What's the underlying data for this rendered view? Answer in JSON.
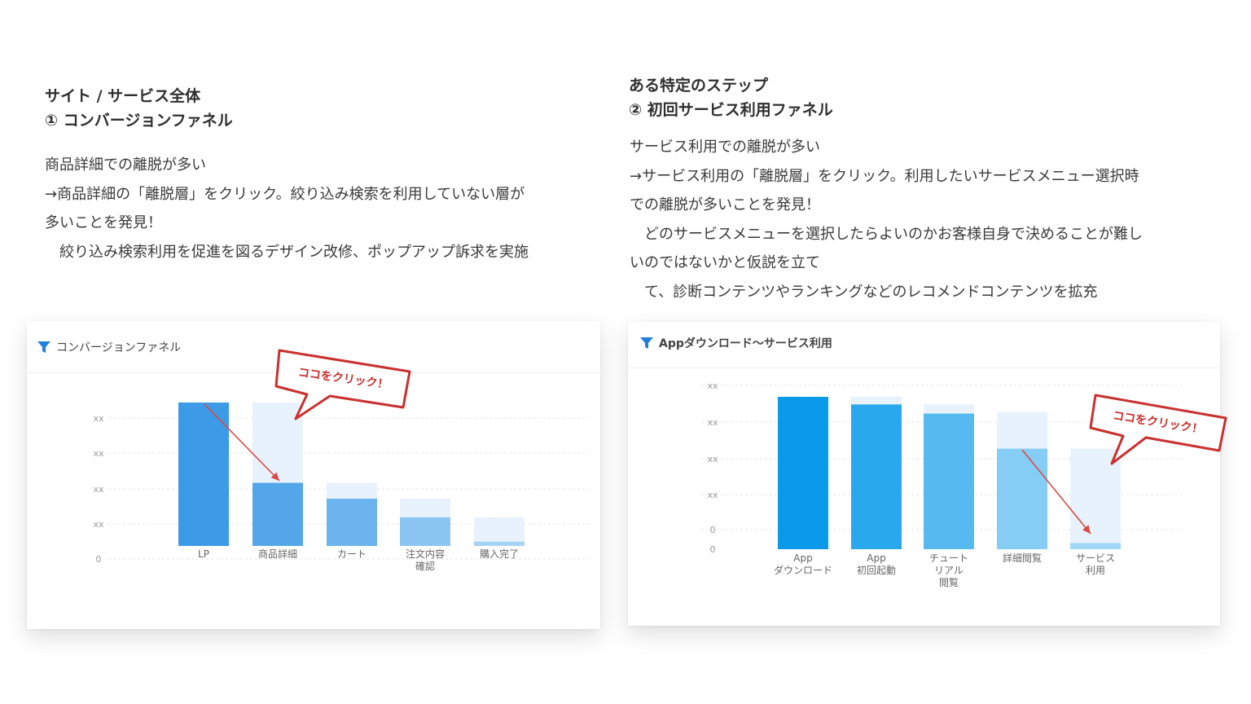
{
  "left": {
    "heading_line1": "サイト / サービス全体",
    "heading_line2": "① コンバージョンファネル",
    "body": [
      "商品詳細での離脱が多い",
      "→商品詳細の「離脱層」をクリック。絞り込み検索を利用していない層が",
      "多いことを発見！",
      "　絞り込み検索利用を促進を図るデザイン改修、ポップアップ訴求を実施"
    ]
  },
  "right": {
    "heading_line1": "ある特定のステップ",
    "heading_line2": "② 初回サービス利用ファネル",
    "body": [
      "サービス利用での離脱が多い",
      "→サービス利用の「離脱層」をクリック。利用したいサービスメニュー選択時",
      "での離脱が多いことを発見！",
      "　どのサービスメニューを選択したらよいのかお客様自身で決めることが難し",
      "いのではないかと仮説を立て",
      "　て、診断コンテンツやランキングなどのレコメンドコンテンツを拡充"
    ]
  },
  "colors": {
    "accent_blue": "#1f7fe0",
    "callout_red": "#c8312f",
    "dropoff_fill": "#e8f2fc"
  },
  "icons": {
    "card_title": "funnel-icon"
  },
  "chart_data": [
    {
      "type": "bar",
      "title": "コンバージョンファネル",
      "categories": [
        "LP",
        "商品詳細",
        "カート",
        "注文内容\n確認",
        "購入完了"
      ],
      "series": [
        {
          "values": [
            100,
            44,
            33,
            20,
            3
          ]
        },
        {
          "values": [
            0,
            56,
            11,
            13,
            17
          ]
        }
      ],
      "ytick_labels": [
        "xx",
        "xx",
        "xx",
        "xx",
        "0"
      ],
      "ylim": [
        0,
        100
      ],
      "grid": true,
      "bar_colors": [
        "#3d9ae6",
        "#53a6ea",
        "#6cb4ee",
        "#8bc5f2",
        "#a6d3f5"
      ],
      "annotation": "ココをクリック！"
    },
    {
      "type": "bar",
      "title": "Appダウンロード〜サービス利用",
      "categories": [
        "App\nダウンロード",
        "App\n初回起動",
        "チュート\nリアル\n閲覧",
        "詳細閲覧",
        "サービス\n利用"
      ],
      "series": [
        {
          "values": [
            100,
            95,
            89,
            66,
            4
          ]
        },
        {
          "values": [
            0,
            5,
            6,
            24,
            62
          ]
        }
      ],
      "ytick_labels": [
        "xx",
        "xx",
        "xx",
        "xx",
        "0",
        "0"
      ],
      "ylim": [
        0,
        100
      ],
      "grid": true,
      "bar_colors": [
        "#0b9aea",
        "#2aa8ed",
        "#56b9f0",
        "#86cdf5",
        "#9fd7f7"
      ],
      "annotation": "ココをクリック！"
    }
  ]
}
